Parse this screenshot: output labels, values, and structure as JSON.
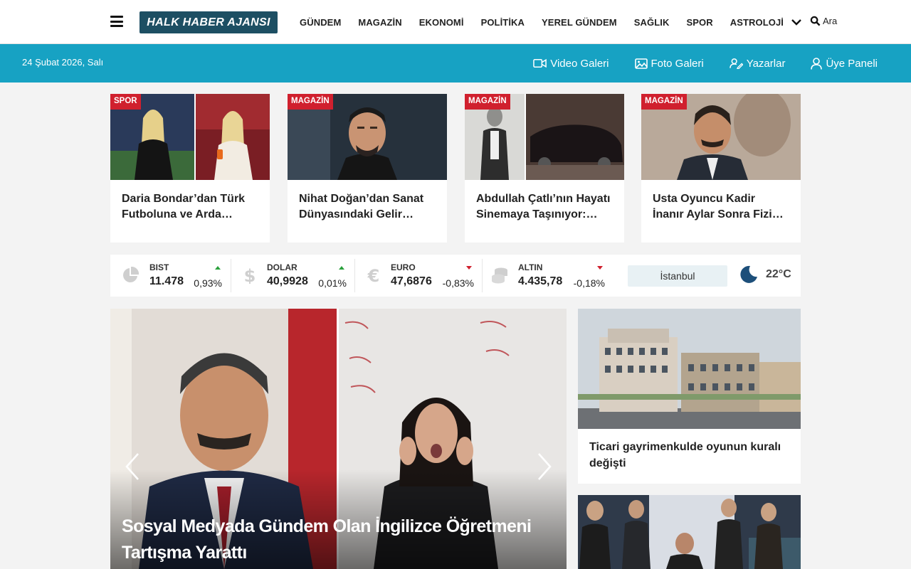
{
  "header": {
    "logo_text": "HALK HABER AJANSI",
    "nav": [
      "GÜNDEM",
      "MAGAZİN",
      "EKONOMİ",
      "POLİTİKA",
      "YEREL GÜNDEM",
      "SAĞLIK",
      "SPOR",
      "ASTROLOJİ"
    ],
    "search_label": "Ara"
  },
  "subbar": {
    "date": "24 Şubat 2026, Salı",
    "links": {
      "video": "Video Galeri",
      "photo": "Foto Galeri",
      "writers": "Yazarlar",
      "member": "Üye Paneli"
    }
  },
  "top_cards": [
    {
      "badge": "SPOR",
      "title": "Daria Bondar’dan Türk Futboluna ve Arda Güler’e Övgü"
    },
    {
      "badge": "MAGAZİN",
      "title": "Nihat Doğan’dan Sanat Dünyasındaki Gelir Açıklaması"
    },
    {
      "badge": "MAGAZİN",
      "title": "Abdullah Çatlı’nın Hayatı Sinemaya Taşınıyor: Oyuncu Kadrosu Belli Oldu"
    },
    {
      "badge": "MAGAZİN",
      "title": "Usta Oyuncu Kadir İnanır Aylar Sonra Fizik Tedavi Görüntüsüyle Ortaya Çıktı"
    }
  ],
  "markets": [
    {
      "name": "BIST",
      "value": "11.478",
      "change": "0,93%",
      "direction": "up",
      "icon": "pie-chart-icon"
    },
    {
      "name": "DOLAR",
      "value": "40,9928",
      "change": "0,01%",
      "direction": "up",
      "icon": "dollar-icon"
    },
    {
      "name": "EURO",
      "value": "47,6876",
      "change": "-0,83%",
      "direction": "down",
      "icon": "euro-icon"
    },
    {
      "name": "ALTIN",
      "value": "4.435,78",
      "change": "-0,18%",
      "direction": "down",
      "icon": "coins-icon"
    }
  ],
  "weather": {
    "city": "İstanbul",
    "temp": "22°C",
    "icon": "moon-icon"
  },
  "slider": {
    "headline": "Sosyal Medyada Gündem Olan İngilizce Öğretmeni Tartışma Yarattı"
  },
  "side_cards": [
    {
      "title": "Ticari gayrimenkulde oyunun kuralı değişti"
    }
  ],
  "colors": {
    "header_blue": "#17a2c3",
    "logo_bg": "#1d4f63",
    "badge_red": "#d0202e"
  }
}
